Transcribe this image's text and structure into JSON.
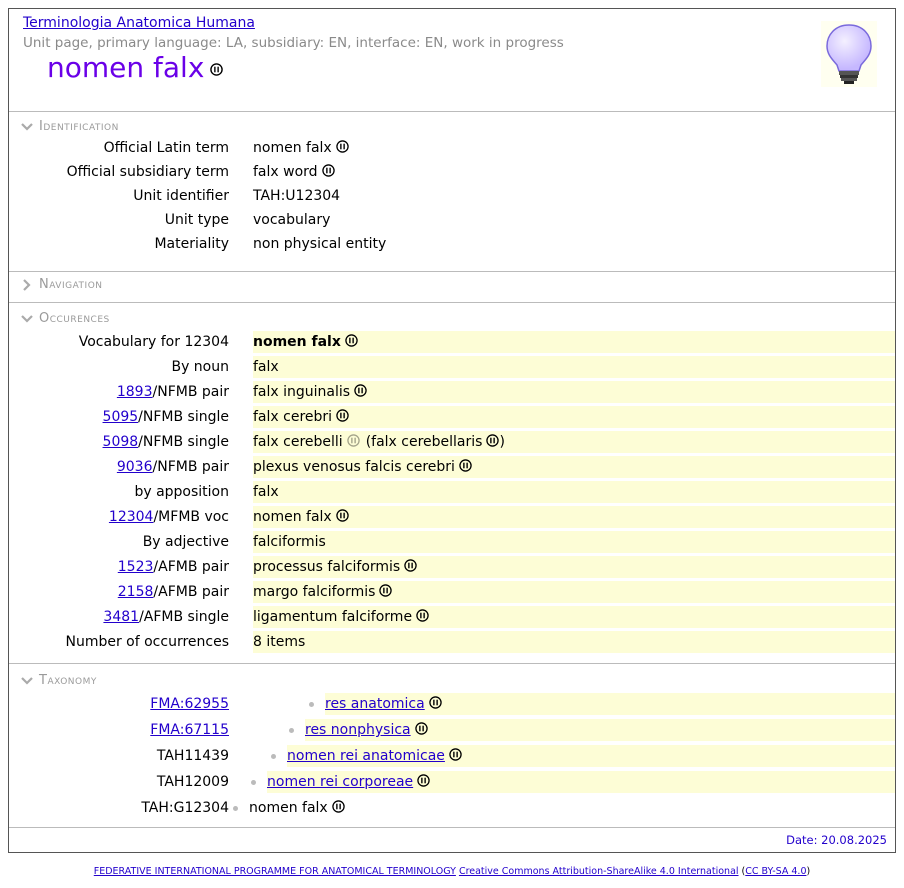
{
  "header": {
    "site_title": "Terminologia Anatomica Humana",
    "subtitle": "Unit page, primary language: LA, subsidiary: EN, interface: EN, work in progress",
    "page_title": "nomen falx",
    "bulb_icon": "lightbulb-icon"
  },
  "identification": {
    "heading": "Identification",
    "rows": [
      {
        "label": "Official Latin term",
        "value": "nomen falx",
        "icon": true
      },
      {
        "label": "Official subsidiary term",
        "value": "falx word",
        "icon": true
      },
      {
        "label": "Unit identifier",
        "value": "TAH:U12304",
        "icon": false
      },
      {
        "label": "Unit type",
        "value": "vocabulary",
        "icon": false
      },
      {
        "label": "Materiality",
        "value": "non physical entity",
        "icon": false
      }
    ]
  },
  "navigation": {
    "heading": "Navigation"
  },
  "occurrences": {
    "heading": "Occurences",
    "rows": [
      {
        "link": "",
        "label": "Vocabulary for 12304",
        "value": "nomen falx",
        "bold": true,
        "icon": true
      },
      {
        "link": "",
        "label": "By noun",
        "value": "falx",
        "icon": false
      },
      {
        "link": "1893",
        "label": "/NFMB pair",
        "value": "falx inguinalis",
        "icon": true
      },
      {
        "link": "5095",
        "label": "/NFMB single",
        "value": "falx cerebri",
        "icon": true
      },
      {
        "link": "5098",
        "label": "/NFMB single",
        "value": "falx cerebelli",
        "icon": "faint",
        "extra": "(falx cerebellaris",
        "extra_close": ")"
      },
      {
        "link": "9036",
        "label": "/NFMB pair",
        "value": "plexus venosus falcis cerebri",
        "icon": true
      },
      {
        "link": "",
        "label": "by apposition",
        "value": "falx",
        "icon": false
      },
      {
        "link": "12304",
        "label": "/MFMB voc",
        "value": "nomen falx",
        "icon": true
      },
      {
        "link": "",
        "label": "By adjective",
        "value": "falciformis",
        "icon": false
      },
      {
        "link": "1523",
        "label": "/AFMB pair",
        "value": "processus falciformis",
        "icon": true
      },
      {
        "link": "2158",
        "label": "/AFMB pair",
        "value": "margo falciformis",
        "icon": true
      },
      {
        "link": "3481",
        "label": "/AFMB single",
        "value": "ligamentum falciforme",
        "icon": true
      },
      {
        "link": "",
        "label": "Number of occurrences",
        "value": "8 items",
        "icon": false
      }
    ]
  },
  "taxonomy": {
    "heading": "Taxonomy",
    "rows": [
      {
        "label": "FMA:62955",
        "label_link": true,
        "value": "res anatomica",
        "value_link": true
      },
      {
        "label": "FMA:67115",
        "label_link": true,
        "value": "res nonphysica",
        "value_link": true
      },
      {
        "label": "TAH11439",
        "label_link": false,
        "value": "nomen rei anatomicae",
        "value_link": true
      },
      {
        "label": "TAH12009",
        "label_link": false,
        "value": "nomen rei corporeae",
        "value_link": true
      },
      {
        "label": "TAH:G12304",
        "label_link": false,
        "value": "nomen falx",
        "value_link": false
      }
    ]
  },
  "date": "Date: 20.08.2025",
  "footer": {
    "programme": "FEDERATIVE INTERNATIONAL PROGRAMME FOR ANATOMICAL TERMINOLOGY",
    "license": "Creative Commons Attribution-ShareAlike 4.0 International",
    "license_short": "CC BY-SA 4.0"
  }
}
